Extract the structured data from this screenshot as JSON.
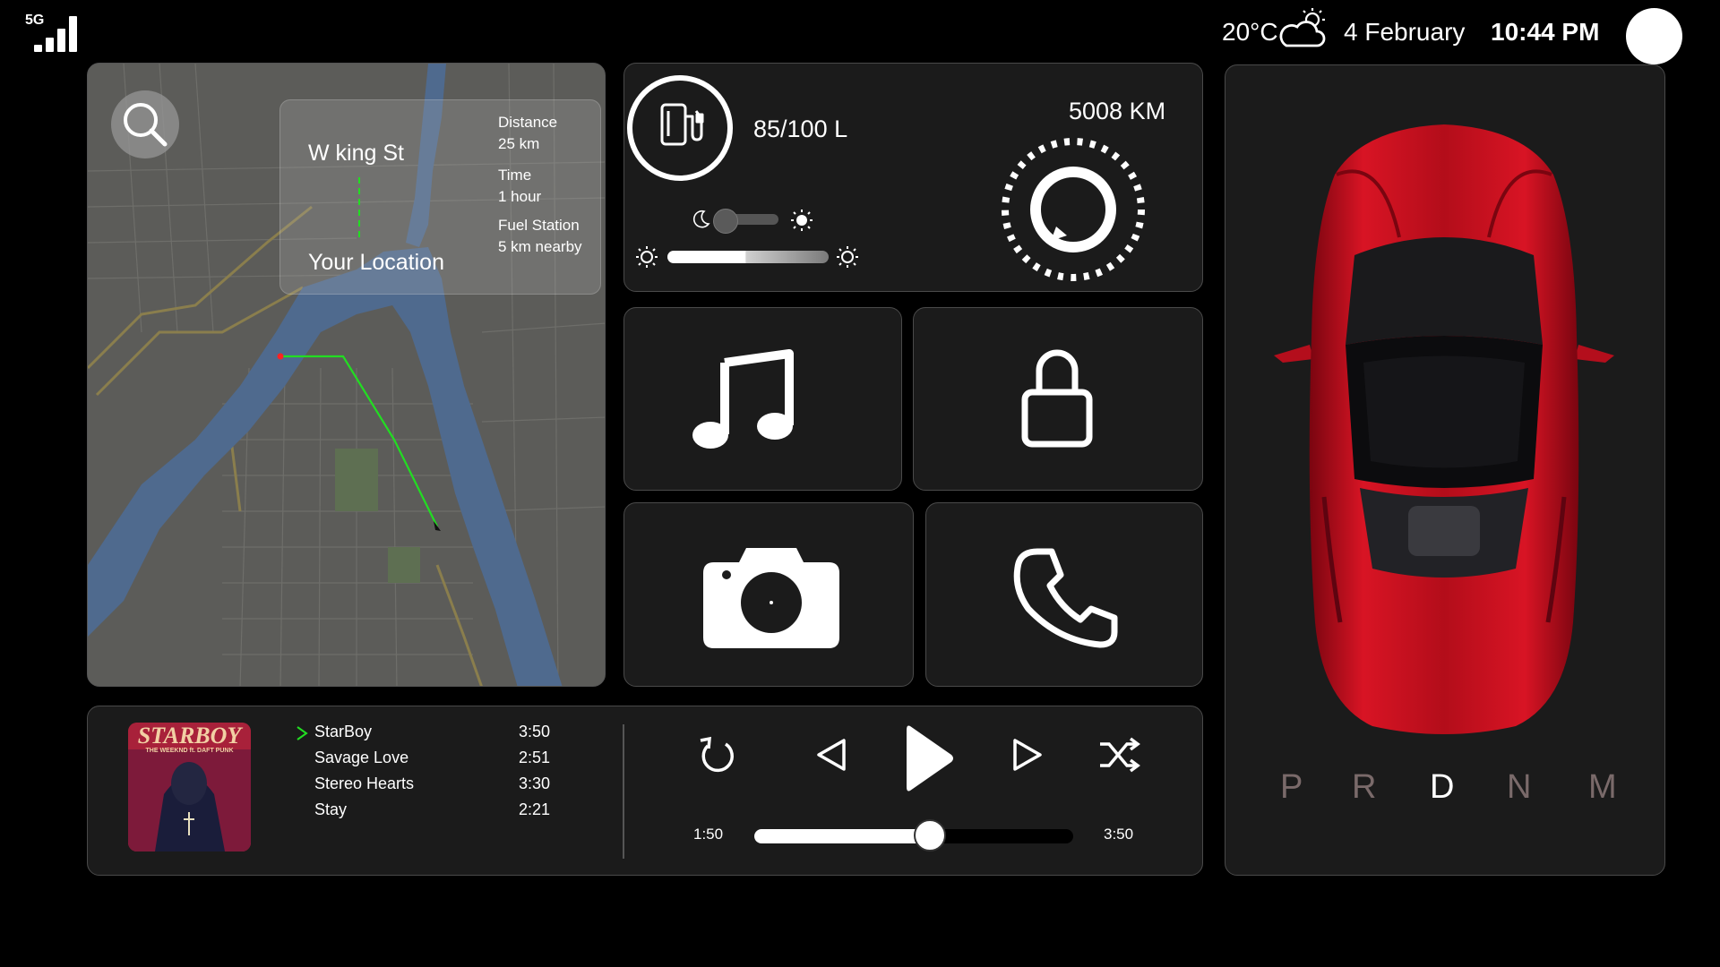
{
  "status_bar": {
    "network": "5G",
    "temperature": "20°C",
    "weather_icon": "partly-cloudy-icon",
    "date": "4 February",
    "time": "10:44 PM"
  },
  "navigation": {
    "destination": "W king St",
    "origin": "Your Location",
    "distance_label": "Distance",
    "distance_value": "25 km",
    "time_label": "Time",
    "time_value": "1 hour",
    "fuel_label": "Fuel Station",
    "fuel_value": "5 km nearby"
  },
  "vehicle": {
    "fuel_level": "85/100 L",
    "odometer": "5008 KM",
    "theme_toggle_level": 0.1,
    "brightness_level": 0.48
  },
  "shortcuts": [
    "music-icon",
    "lock-icon",
    "camera-icon",
    "phone-icon"
  ],
  "player": {
    "playlist": [
      {
        "title": "StarBoy",
        "duration": "3:50",
        "playing": true
      },
      {
        "title": "Savage Love",
        "duration": "2:51",
        "playing": false
      },
      {
        "title": "Stereo Hearts",
        "duration": "3:30",
        "playing": false
      },
      {
        "title": "Stay",
        "duration": "2:21",
        "playing": false
      }
    ],
    "album_title": "STARBOY",
    "album_artist": "THE WEEKND ft. DAFT PUNK",
    "elapsed": "1:50",
    "total": "3:50",
    "progress": 0.55
  },
  "gears": [
    "P",
    "R",
    "D",
    "N",
    "M"
  ],
  "active_gear": "D",
  "colors": {
    "accent_green": "#22dd22",
    "route_start": "#ff2222",
    "car_red": "#c8101c",
    "panel_bg": "#1b1b1b"
  }
}
